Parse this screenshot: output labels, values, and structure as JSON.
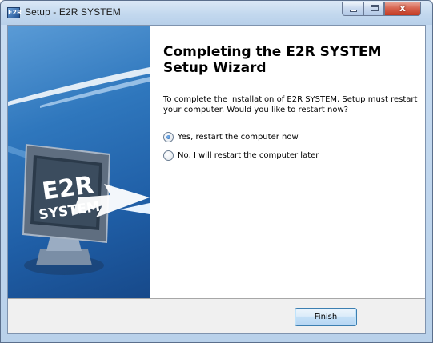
{
  "window": {
    "title": "Setup - E2R SYSTEM",
    "app_icon_text": "E2R",
    "close_glyph": "x"
  },
  "side_panel": {
    "logo_text_line1": "E2R",
    "logo_text_line2": "SYSTEM"
  },
  "main": {
    "heading_line1": "Completing the E2R SYSTEM",
    "heading_line2": "Setup Wizard",
    "description": "To complete the installation of E2R SYSTEM, Setup must restart your computer. Would you like to restart now?",
    "options": [
      {
        "label": "Yes, restart the computer now",
        "selected": true
      },
      {
        "label": "No, I will restart the computer later",
        "selected": false
      }
    ]
  },
  "footer": {
    "finish_label": "Finish"
  },
  "colors": {
    "panel_blue": "#1f5ea6",
    "accent": "#3c7fb1"
  }
}
